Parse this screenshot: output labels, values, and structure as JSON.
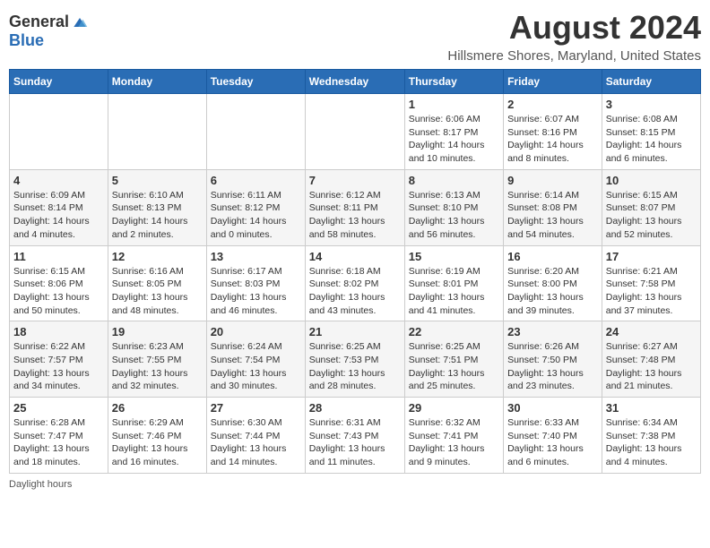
{
  "header": {
    "logo": {
      "general": "General",
      "blue": "Blue"
    },
    "title": "August 2024",
    "location": "Hillsmere Shores, Maryland, United States"
  },
  "weekdays": [
    "Sunday",
    "Monday",
    "Tuesday",
    "Wednesday",
    "Thursday",
    "Friday",
    "Saturday"
  ],
  "weeks": [
    [
      {
        "day": "",
        "info": ""
      },
      {
        "day": "",
        "info": ""
      },
      {
        "day": "",
        "info": ""
      },
      {
        "day": "",
        "info": ""
      },
      {
        "day": "1",
        "info": "Sunrise: 6:06 AM\nSunset: 8:17 PM\nDaylight: 14 hours\nand 10 minutes."
      },
      {
        "day": "2",
        "info": "Sunrise: 6:07 AM\nSunset: 8:16 PM\nDaylight: 14 hours\nand 8 minutes."
      },
      {
        "day": "3",
        "info": "Sunrise: 6:08 AM\nSunset: 8:15 PM\nDaylight: 14 hours\nand 6 minutes."
      }
    ],
    [
      {
        "day": "4",
        "info": "Sunrise: 6:09 AM\nSunset: 8:14 PM\nDaylight: 14 hours\nand 4 minutes."
      },
      {
        "day": "5",
        "info": "Sunrise: 6:10 AM\nSunset: 8:13 PM\nDaylight: 14 hours\nand 2 minutes."
      },
      {
        "day": "6",
        "info": "Sunrise: 6:11 AM\nSunset: 8:12 PM\nDaylight: 14 hours\nand 0 minutes."
      },
      {
        "day": "7",
        "info": "Sunrise: 6:12 AM\nSunset: 8:11 PM\nDaylight: 13 hours\nand 58 minutes."
      },
      {
        "day": "8",
        "info": "Sunrise: 6:13 AM\nSunset: 8:10 PM\nDaylight: 13 hours\nand 56 minutes."
      },
      {
        "day": "9",
        "info": "Sunrise: 6:14 AM\nSunset: 8:08 PM\nDaylight: 13 hours\nand 54 minutes."
      },
      {
        "day": "10",
        "info": "Sunrise: 6:15 AM\nSunset: 8:07 PM\nDaylight: 13 hours\nand 52 minutes."
      }
    ],
    [
      {
        "day": "11",
        "info": "Sunrise: 6:15 AM\nSunset: 8:06 PM\nDaylight: 13 hours\nand 50 minutes."
      },
      {
        "day": "12",
        "info": "Sunrise: 6:16 AM\nSunset: 8:05 PM\nDaylight: 13 hours\nand 48 minutes."
      },
      {
        "day": "13",
        "info": "Sunrise: 6:17 AM\nSunset: 8:03 PM\nDaylight: 13 hours\nand 46 minutes."
      },
      {
        "day": "14",
        "info": "Sunrise: 6:18 AM\nSunset: 8:02 PM\nDaylight: 13 hours\nand 43 minutes."
      },
      {
        "day": "15",
        "info": "Sunrise: 6:19 AM\nSunset: 8:01 PM\nDaylight: 13 hours\nand 41 minutes."
      },
      {
        "day": "16",
        "info": "Sunrise: 6:20 AM\nSunset: 8:00 PM\nDaylight: 13 hours\nand 39 minutes."
      },
      {
        "day": "17",
        "info": "Sunrise: 6:21 AM\nSunset: 7:58 PM\nDaylight: 13 hours\nand 37 minutes."
      }
    ],
    [
      {
        "day": "18",
        "info": "Sunrise: 6:22 AM\nSunset: 7:57 PM\nDaylight: 13 hours\nand 34 minutes."
      },
      {
        "day": "19",
        "info": "Sunrise: 6:23 AM\nSunset: 7:55 PM\nDaylight: 13 hours\nand 32 minutes."
      },
      {
        "day": "20",
        "info": "Sunrise: 6:24 AM\nSunset: 7:54 PM\nDaylight: 13 hours\nand 30 minutes."
      },
      {
        "day": "21",
        "info": "Sunrise: 6:25 AM\nSunset: 7:53 PM\nDaylight: 13 hours\nand 28 minutes."
      },
      {
        "day": "22",
        "info": "Sunrise: 6:25 AM\nSunset: 7:51 PM\nDaylight: 13 hours\nand 25 minutes."
      },
      {
        "day": "23",
        "info": "Sunrise: 6:26 AM\nSunset: 7:50 PM\nDaylight: 13 hours\nand 23 minutes."
      },
      {
        "day": "24",
        "info": "Sunrise: 6:27 AM\nSunset: 7:48 PM\nDaylight: 13 hours\nand 21 minutes."
      }
    ],
    [
      {
        "day": "25",
        "info": "Sunrise: 6:28 AM\nSunset: 7:47 PM\nDaylight: 13 hours\nand 18 minutes."
      },
      {
        "day": "26",
        "info": "Sunrise: 6:29 AM\nSunset: 7:46 PM\nDaylight: 13 hours\nand 16 minutes."
      },
      {
        "day": "27",
        "info": "Sunrise: 6:30 AM\nSunset: 7:44 PM\nDaylight: 13 hours\nand 14 minutes."
      },
      {
        "day": "28",
        "info": "Sunrise: 6:31 AM\nSunset: 7:43 PM\nDaylight: 13 hours\nand 11 minutes."
      },
      {
        "day": "29",
        "info": "Sunrise: 6:32 AM\nSunset: 7:41 PM\nDaylight: 13 hours\nand 9 minutes."
      },
      {
        "day": "30",
        "info": "Sunrise: 6:33 AM\nSunset: 7:40 PM\nDaylight: 13 hours\nand 6 minutes."
      },
      {
        "day": "31",
        "info": "Sunrise: 6:34 AM\nSunset: 7:38 PM\nDaylight: 13 hours\nand 4 minutes."
      }
    ]
  ],
  "footer": {
    "note": "Daylight hours"
  }
}
